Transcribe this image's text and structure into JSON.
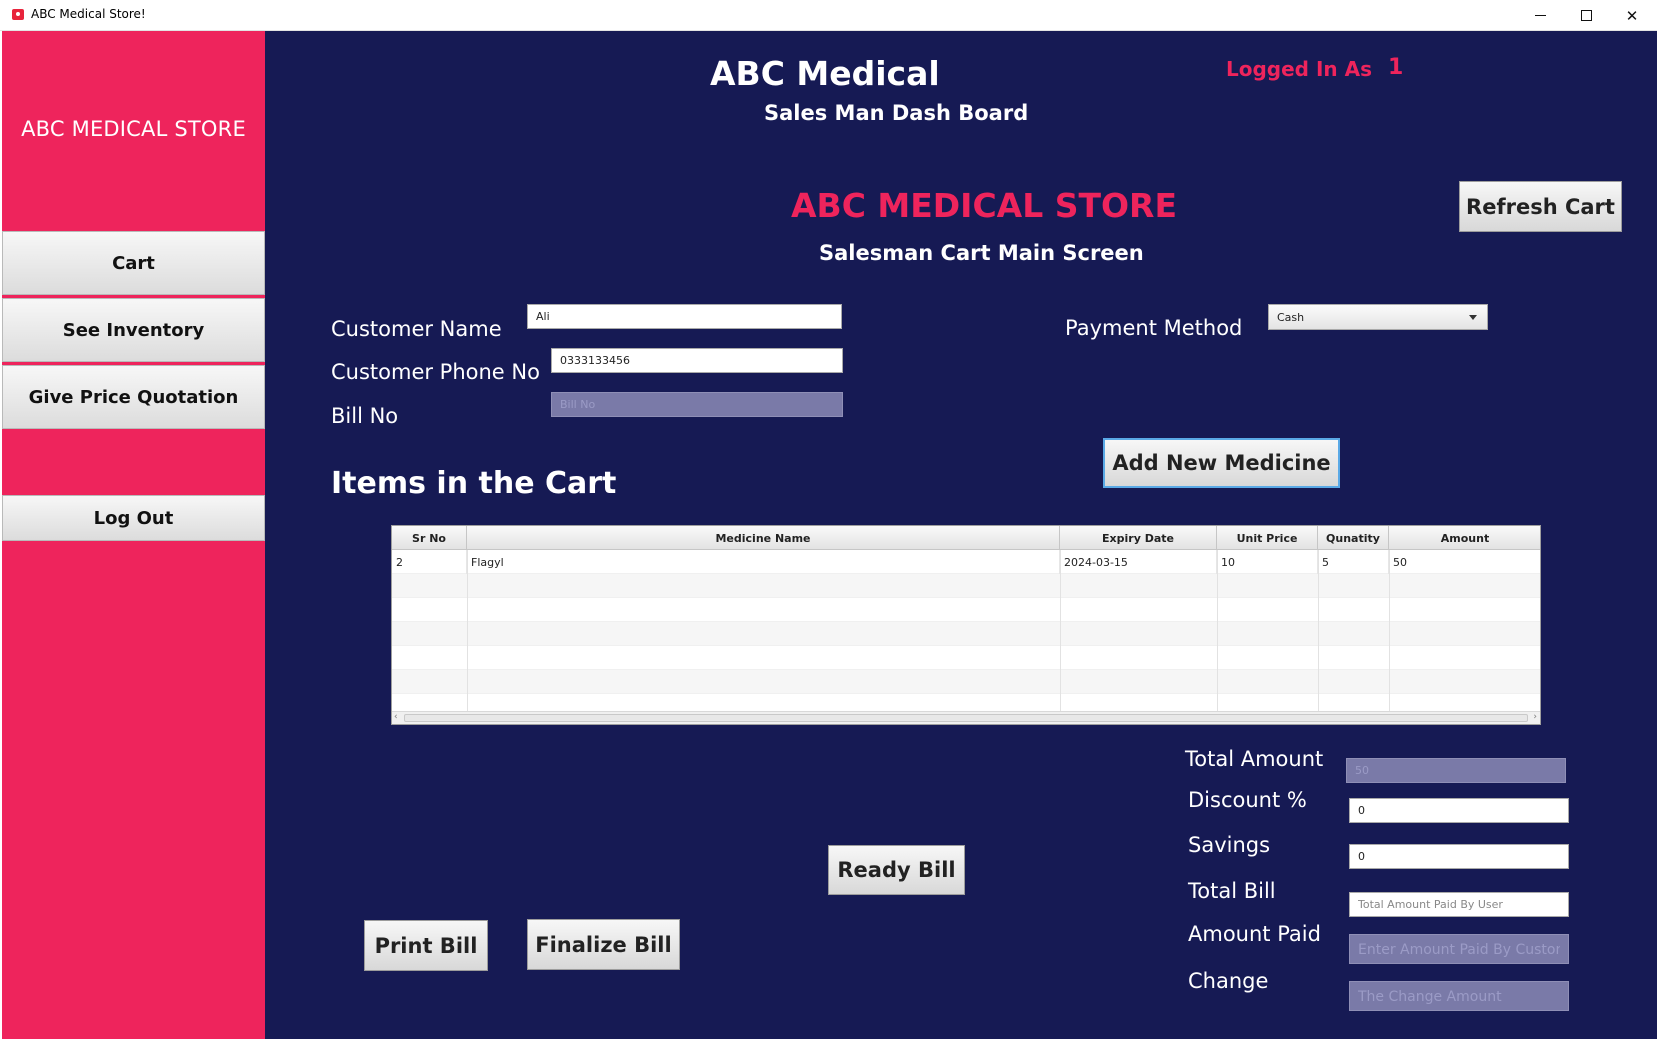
{
  "window": {
    "title": "ABC Medical Store!"
  },
  "sidebar": {
    "brand": "ABC MEDICAL STORE",
    "items": [
      {
        "label": "Cart"
      },
      {
        "label": "See Inventory"
      },
      {
        "label": "Give Price Quotation"
      }
    ],
    "logout_label": "Log Out"
  },
  "header": {
    "title": "ABC Medical",
    "subtitle": "Sales Man Dash Board",
    "logged_in_label": "Logged In As",
    "logged_in_value": "1"
  },
  "main": {
    "store_title": "ABC MEDICAL STORE",
    "screen_title": "Salesman Cart Main Screen",
    "refresh_label": "Refresh Cart",
    "customer_name_label": "Customer Name",
    "customer_name_value": "Ali",
    "customer_phone_label": "Customer Phone No",
    "customer_phone_value": "0333133456",
    "bill_no_label": "Bill No",
    "bill_no_placeholder": "Bill No",
    "payment_method_label": "Payment Method",
    "payment_method_value": "Cash",
    "add_medicine_label": "Add New Medicine",
    "items_title": "Items in the Cart"
  },
  "table": {
    "columns": [
      "Sr No",
      "Medicine Name",
      "Expiry Date",
      "Unit Price",
      "Qunatity",
      "Amount"
    ],
    "rows": [
      [
        "2",
        "Flagyl",
        "2024-03-15",
        "10",
        "5",
        "50"
      ]
    ]
  },
  "totals": {
    "total_amount_label": "Total Amount",
    "total_amount_value": "50",
    "discount_label": "Discount %",
    "discount_value": "0",
    "savings_label": "Savings",
    "savings_value": "0",
    "total_bill_label": "Total Bill",
    "total_bill_placeholder": "Total Amount Paid By User",
    "amount_paid_label": "Amount Paid",
    "amount_paid_placeholder": "Enter Amount Paid By Customer",
    "change_label": "Change",
    "change_placeholder": "The Change Amount"
  },
  "actions": {
    "ready_bill_label": "Ready Bill",
    "print_bill_label": "Print Bill",
    "finalize_bill_label": "Finalize Bill"
  }
}
